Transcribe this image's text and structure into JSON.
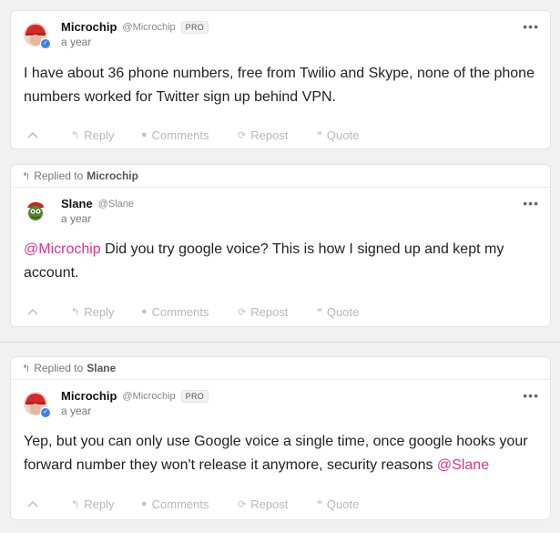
{
  "posts": [
    {
      "replied_to": null,
      "author": {
        "name": "Microchip",
        "handle": "@Microchip",
        "badge": "PRO",
        "avatar": "red-hat-avatar"
      },
      "time": "a year",
      "text_parts": {
        "mention_before": "",
        "text": "I have about 36 phone numbers, free from Twilio and Skype, none of the phone numbers worked for Twitter sign up behind VPN.",
        "mention_after": ""
      }
    },
    {
      "replied_to": {
        "prefix": "Replied to",
        "name": "Microchip"
      },
      "author": {
        "name": "Slane",
        "handle": "@Slane",
        "badge": "",
        "avatar": "frog-avatar"
      },
      "time": "a year",
      "text_parts": {
        "mention_before": "@Microchip",
        "text": " Did you try google voice? This is how I signed up and kept my account.",
        "mention_after": ""
      }
    },
    {
      "replied_to": {
        "prefix": "Replied to",
        "name": "Slane"
      },
      "author": {
        "name": "Microchip",
        "handle": "@Microchip",
        "badge": "PRO",
        "avatar": "red-hat-avatar"
      },
      "time": "a year",
      "text_parts": {
        "mention_before": "",
        "text": "Yep, but you can only use Google voice a single time, once google hooks your forward number they won't release it anymore, security reasons ",
        "mention_after": "@Slane"
      }
    }
  ],
  "actions": {
    "upvote_icon": "chevron-up-icon",
    "reply": "Reply",
    "comments": "Comments",
    "repost": "Repost",
    "quote": "Quote"
  },
  "more_label": "•••",
  "colors": {
    "mention": "#e0338a",
    "verified": "#3b82e8",
    "action": "#b8b8b8",
    "background": "#f1f1f1"
  }
}
